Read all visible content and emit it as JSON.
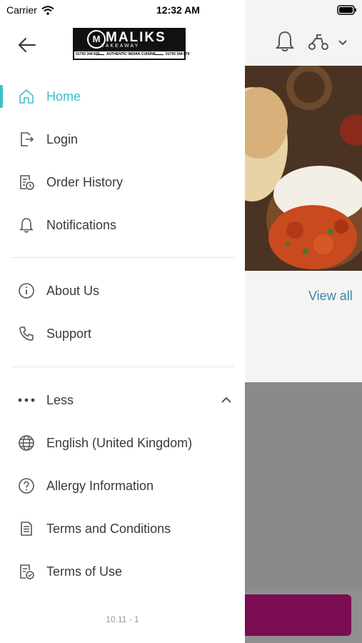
{
  "status_bar": {
    "carrier": "Carrier",
    "time": "12:32 AM"
  },
  "logo": {
    "title": "MALIKS",
    "subtitle": "TAKEAWAY",
    "tagline": "AUTHENTIC INDIAN CUISINE",
    "left_text": "01793 344 870",
    "right_text": "01793 344 870"
  },
  "menu_primary": [
    {
      "label": "Home",
      "icon": "home-icon",
      "active": true
    },
    {
      "label": "Login",
      "icon": "login-icon",
      "active": false
    },
    {
      "label": "Order History",
      "icon": "order-history-icon",
      "active": false
    },
    {
      "label": "Notifications",
      "icon": "bell-icon",
      "active": false
    }
  ],
  "menu_secondary": [
    {
      "label": "About Us",
      "icon": "info-icon"
    },
    {
      "label": "Support",
      "icon": "phone-icon"
    }
  ],
  "menu_more": {
    "label": "Less",
    "icon": "more-dots-icon",
    "expanded": true
  },
  "menu_extra": [
    {
      "label": "English (United Kingdom)",
      "icon": "globe-icon"
    },
    {
      "label": "Allergy Information",
      "icon": "question-icon"
    },
    {
      "label": "Terms and Conditions",
      "icon": "document-icon"
    },
    {
      "label": "Terms of Use",
      "icon": "document-check-icon"
    }
  ],
  "version": "10.11 - 1",
  "background_page": {
    "view_all": "View all"
  },
  "colors": {
    "accent": "#3dbfc9",
    "text": "#3a3a3a",
    "brand": "#7a0d52"
  }
}
